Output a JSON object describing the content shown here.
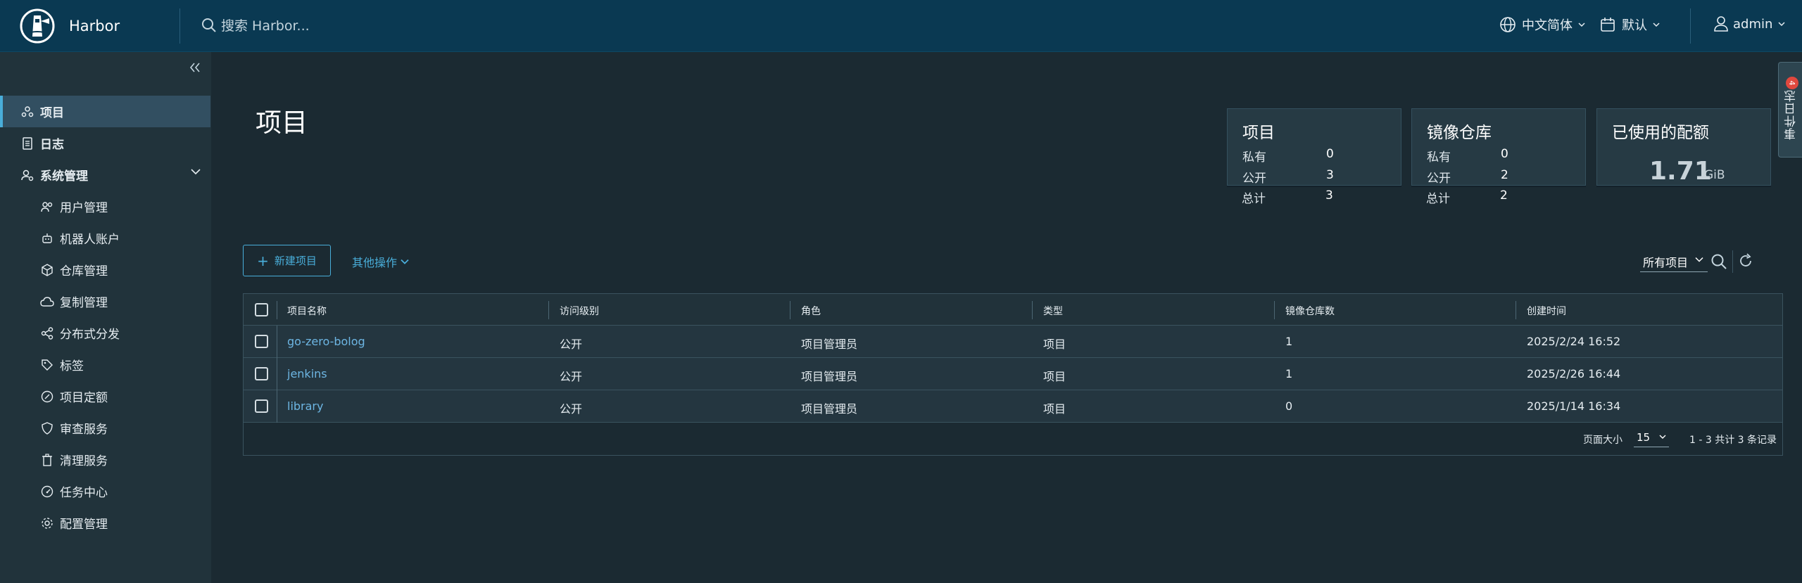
{
  "header": {
    "brand": "Harbor",
    "search_placeholder": "搜索 Harbor...",
    "language": "中文简体",
    "theme": "默认",
    "user": "admin"
  },
  "sidebar": {
    "items": [
      {
        "label": "项目",
        "icon": "projects-icon",
        "active": true
      },
      {
        "label": "日志",
        "icon": "logs-icon"
      },
      {
        "label": "系统管理",
        "icon": "admin-icon"
      }
    ],
    "sub_items": [
      {
        "label": "用户管理",
        "icon": "users-icon"
      },
      {
        "label": "机器人账户",
        "icon": "robot-icon"
      },
      {
        "label": "仓库管理",
        "icon": "registry-icon"
      },
      {
        "label": "复制管理",
        "icon": "replication-icon"
      },
      {
        "label": "分布式分发",
        "icon": "distribution-icon"
      },
      {
        "label": "标签",
        "icon": "tag-icon"
      },
      {
        "label": "项目定额",
        "icon": "quota-icon"
      },
      {
        "label": "审查服务",
        "icon": "shield-icon"
      },
      {
        "label": "清理服务",
        "icon": "trash-icon"
      },
      {
        "label": "任务中心",
        "icon": "dashboard-icon"
      },
      {
        "label": "配置管理",
        "icon": "gear-icon"
      }
    ]
  },
  "main": {
    "title": "项目",
    "cards": {
      "projects": {
        "title": "项目",
        "rows": [
          {
            "label": "私有",
            "value": "0"
          },
          {
            "label": "公开",
            "value": "3"
          },
          {
            "label": "总计",
            "value": "3"
          }
        ]
      },
      "repos": {
        "title": "镜像仓库",
        "rows": [
          {
            "label": "私有",
            "value": "0"
          },
          {
            "label": "公开",
            "value": "2"
          },
          {
            "label": "总计",
            "value": "2"
          }
        ]
      },
      "quota": {
        "title": "已使用的配额",
        "value": "1.71",
        "unit": "GiB"
      }
    },
    "toolbar": {
      "new_project": "新建项目",
      "more_actions": "其他操作",
      "filter": "所有项目"
    },
    "table": {
      "headers": [
        "项目名称",
        "访问级别",
        "角色",
        "类型",
        "镜像仓库数",
        "创建时间"
      ],
      "rows": [
        [
          "go-zero-bolog",
          "公开",
          "项目管理员",
          "项目",
          "1",
          "2025/2/24 16:52"
        ],
        [
          "jenkins",
          "公开",
          "项目管理员",
          "项目",
          "1",
          "2025/2/26 16:44"
        ],
        [
          "library",
          "公开",
          "项目管理员",
          "项目",
          "0",
          "2025/1/14 16:34"
        ]
      ],
      "page_size_label": "页面大小",
      "page_size": "15",
      "record_summary": "1 - 3 共计 3 条记录"
    },
    "event_log": {
      "label": "事件日志",
      "badge": "4"
    }
  },
  "colors": {
    "header_bg": "#0a3952",
    "sidebar_bg": "#21333b",
    "page_bg": "#1b2a32",
    "accent": "#49aeda",
    "active_nav": "#324f61",
    "badge": "#e0483e"
  }
}
